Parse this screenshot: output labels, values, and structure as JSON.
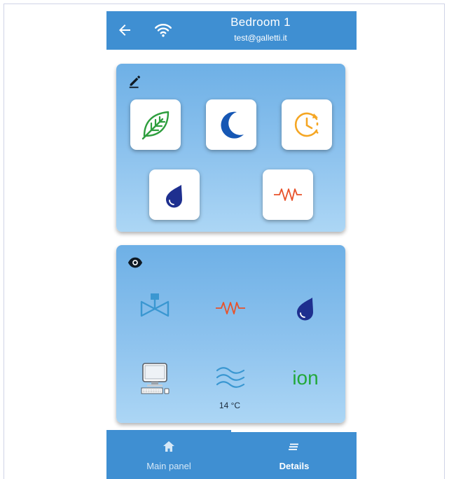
{
  "header": {
    "title": "Bedroom 1",
    "subtitle": "test@galletti.it",
    "back_icon": "arrow-left-icon",
    "wifi_icon": "wifi-icon"
  },
  "controls_card": {
    "edit_icon": "pencil-icon",
    "buttons": [
      {
        "name": "eco",
        "icon": "leaf-icon"
      },
      {
        "name": "night",
        "icon": "moon-icon"
      },
      {
        "name": "timer",
        "icon": "clock-icon"
      },
      {
        "name": "dehumidify",
        "icon": "water-drop-icon"
      },
      {
        "name": "heater",
        "icon": "resistor-icon"
      }
    ]
  },
  "status_card": {
    "view_icon": "eye-icon",
    "indicators": [
      {
        "name": "valve",
        "icon": "valve-icon"
      },
      {
        "name": "heater",
        "icon": "resistor-icon"
      },
      {
        "name": "humidity",
        "icon": "water-drop-icon"
      },
      {
        "name": "computer",
        "icon": "computer-icon"
      },
      {
        "name": "air-flow",
        "icon": "wave-icon"
      },
      {
        "name": "ion",
        "label": "ion"
      }
    ],
    "temperature": "14 °C"
  },
  "bottom_nav": {
    "items": [
      {
        "label": "Main panel",
        "icon": "home-icon",
        "active": false
      },
      {
        "label": "Details",
        "icon": "list-icon",
        "active": true
      }
    ]
  },
  "colors": {
    "app_bar": "#3f8fd2",
    "card_top": "#6eb0e6",
    "card_bottom": "#acd6f5",
    "leaf": "#2e9e3e",
    "moon": "#1657b4",
    "clock": "#f5a623",
    "drop": "#1e2f8f",
    "resistor": "#e8522a",
    "valve": "#3a97d1",
    "ion": "#22a83a"
  }
}
